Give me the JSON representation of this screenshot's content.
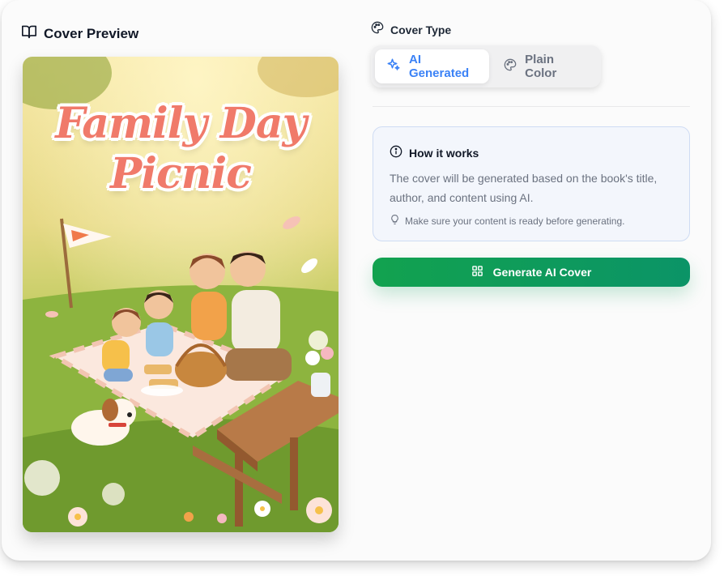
{
  "preview": {
    "title": "Cover Preview",
    "icon": "book-open-icon",
    "cover_title_line1": "Family Day",
    "cover_title_line2": "Picnic"
  },
  "cover_type": {
    "label": "Cover Type",
    "icon": "palette-icon",
    "options": [
      {
        "label": "AI Generated",
        "icon": "sparkles-icon",
        "selected": true
      },
      {
        "label": "Plain Color",
        "icon": "palette-icon",
        "selected": false
      }
    ]
  },
  "how_it_works": {
    "title": "How it works",
    "icon": "info-icon",
    "body": "The cover will be generated based on the book's title, author, and content using AI.",
    "tip": "Make sure your content is ready before generating.",
    "tip_icon": "lightbulb-icon"
  },
  "generate_button": {
    "label": "Generate AI Cover",
    "icon": "grid-icon"
  },
  "colors": {
    "accent_blue": "#3b82f6",
    "button_green": "#12a24f",
    "cover_title": "#f07a6a"
  }
}
